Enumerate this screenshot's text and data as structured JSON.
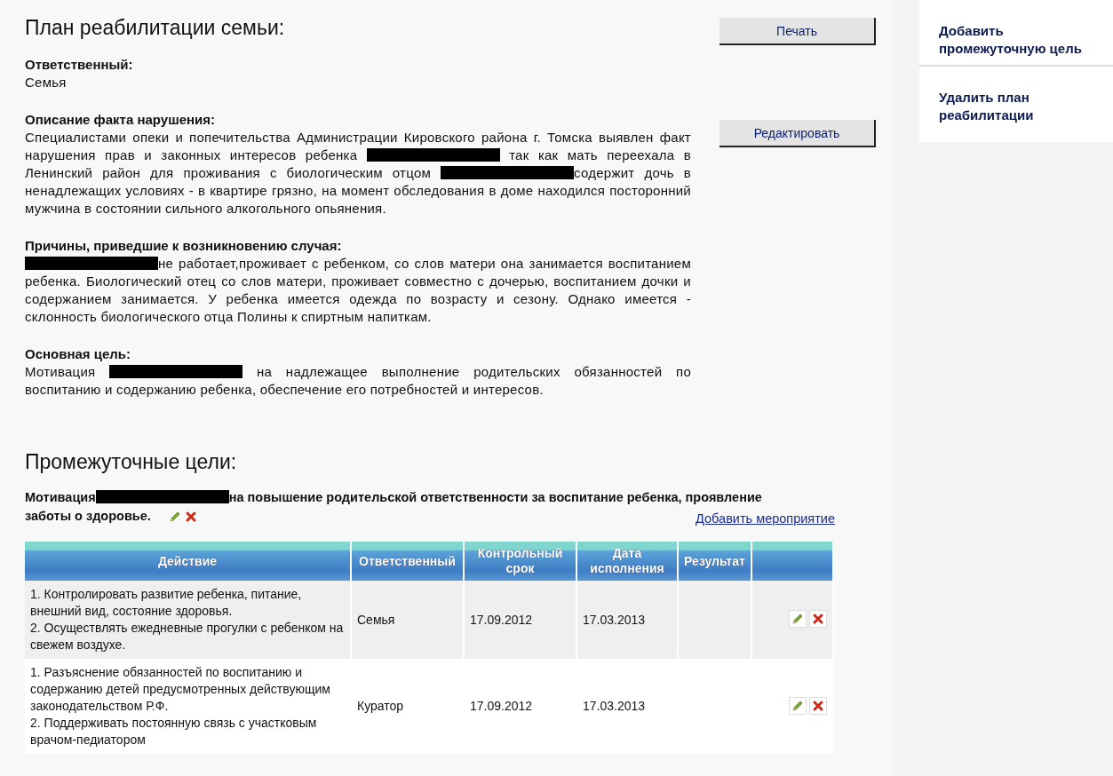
{
  "page_title": "План реабилитации семьи:",
  "buttons": [
    {
      "label": "Печать"
    },
    {
      "label": "Редактировать"
    }
  ],
  "sidebar": {
    "items": [
      {
        "label": "Добавить промежуточную цель"
      },
      {
        "label": "Удалить план реабилитации"
      }
    ]
  },
  "sections": [
    {
      "label": "Ответственный:",
      "parts": [
        {
          "kind": "text",
          "text": "Семья"
        }
      ]
    },
    {
      "label": "Описание факта нарушения:",
      "parts": [
        {
          "kind": "text",
          "text": "Специалистами опеки и попечительства Администрации Кировского района г. Томска выявлен факт нарушения прав и законных интересов ребенка "
        },
        {
          "kind": "redacted"
        },
        {
          "kind": "text",
          "text": " так как мать переехала в Ленинский район для проживания с биологическим отцом "
        },
        {
          "kind": "redacted"
        },
        {
          "kind": "text",
          "text": "содержит дочь в ненадлежащих условиях - в квартире грязно, на момент обследования в доме находился посторонний мужчина в состоянии сильного алкогольного опьянения."
        }
      ]
    },
    {
      "label": "Причины, приведшие к возникновению случая:",
      "parts": [
        {
          "kind": "redacted"
        },
        {
          "kind": "text",
          "text": "не работает,проживает с ребенком, со слов матери она занимается воспитанием ребенка. Биологический отец со слов матери, проживает совместно с дочерью, воспитанием дочки и содержанием занимается. У ребенка имеется одежда по возрасту и сезону. Однако имеется - склонность биологического отца Полины к спиртным напиткам."
        }
      ]
    },
    {
      "label": "Основная цель:",
      "parts": [
        {
          "kind": "text",
          "text": "Мотивация "
        },
        {
          "kind": "redacted"
        },
        {
          "kind": "text",
          "text": " на надлежащее выполнение родительских обязанностей по воспитанию и содержанию ребенка, обеспечение его потребностей и интересов."
        }
      ]
    }
  ],
  "goals_title": "Промежуточные цели:",
  "goal": {
    "parts": [
      {
        "kind": "text",
        "text": "Мотивация"
      },
      {
        "kind": "redacted"
      },
      {
        "kind": "text",
        "text": "на повышение родительской ответственности за воспитание ребенка, проявление заботы о здоровье."
      }
    ],
    "add_link": "Добавить мероприятие"
  },
  "table": {
    "columns": [
      "Действие",
      "Ответственный",
      "Контрольный срок",
      "Дата исполнения",
      "Результат"
    ],
    "rows": [
      {
        "action": [
          "1. Контролировать развитие ребенка, питание, внешний вид, состояние здоровья.",
          "2. Осуществлять ежедневные прогулки с ребенком на свежем воздухе."
        ],
        "responsible": "Семья",
        "deadline": "17.09.2012",
        "done": "17.03.2013"
      },
      {
        "action": [
          "1. Разъяснение обязанностей по воспитанию и содержанию детей предусмотренных действующим законодательством Р.Ф.",
          "2. Поддерживать постоянную связь с участковым врачом-педиатором"
        ],
        "responsible": "Куратор",
        "deadline": "17.09.2012",
        "done": "17.03.2013"
      }
    ]
  }
}
